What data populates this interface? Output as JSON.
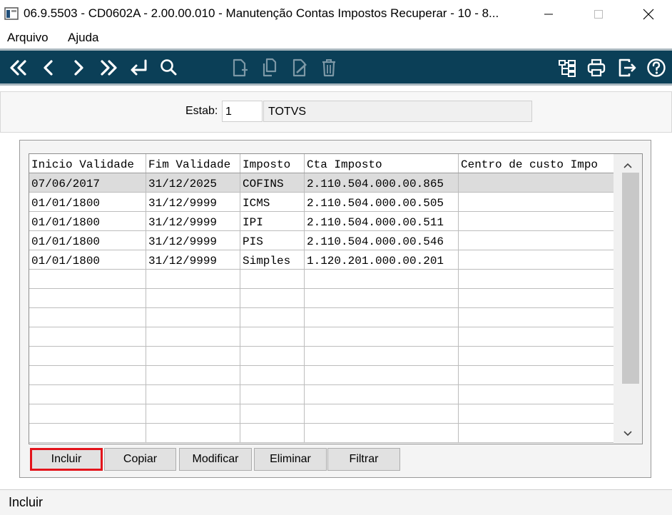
{
  "window": {
    "title": "06.9.5503 - CD0602A - 2.00.00.010 - Manutenção Contas Impostos Recuperar - 10 - 8...",
    "icon": "app-window-icon"
  },
  "menu": {
    "items": [
      {
        "label": "Arquivo"
      },
      {
        "label": "Ajuda"
      }
    ]
  },
  "toolbar": {
    "icons": [
      "first-icon",
      "previous-icon",
      "next-icon",
      "last-icon",
      "goto-icon",
      "search-icon",
      "new-document-icon",
      "copy-document-icon",
      "edit-document-icon",
      "delete-icon",
      "tree-icon",
      "print-icon",
      "exit-icon",
      "help-icon"
    ],
    "background": "#0b3f57"
  },
  "header": {
    "estab_label": "Estab:",
    "estab_code": "1",
    "estab_name": "TOTVS"
  },
  "grid": {
    "columns": [
      "Inicio Validade",
      "Fim Validade",
      "Imposto",
      "Cta Imposto",
      "Centro de custo Impo"
    ],
    "rows": [
      [
        "07/06/2017",
        "31/12/2025",
        "COFINS",
        "2.110.504.000.00.865",
        ""
      ],
      [
        "01/01/1800",
        "31/12/9999",
        "ICMS",
        "2.110.504.000.00.505",
        ""
      ],
      [
        "01/01/1800",
        "31/12/9999",
        "IPI",
        "2.110.504.000.00.511",
        ""
      ],
      [
        "01/01/1800",
        "31/12/9999",
        "PIS",
        "2.110.504.000.00.546",
        ""
      ],
      [
        "01/01/1800",
        "31/12/9999",
        "Simples",
        "1.120.201.000.00.201",
        ""
      ]
    ],
    "selected_row": 0
  },
  "buttons": {
    "incluir": "Incluir",
    "copiar": "Copiar",
    "modificar": "Modificar",
    "eliminar": "Eliminar",
    "filtrar": "Filtrar",
    "highlight_color": "#e3141b"
  },
  "status": {
    "text": "Incluir"
  }
}
